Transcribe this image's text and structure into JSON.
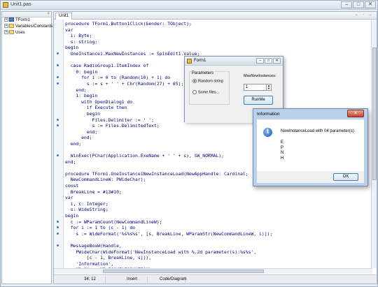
{
  "window": {
    "title": "Unit1.pas",
    "minimize": "–",
    "maximize": "□",
    "close": "✕"
  },
  "project_tree": {
    "close_label": "×",
    "items": [
      {
        "label": "TForm1",
        "icon": "form-icon"
      },
      {
        "label": "Variables/Constants",
        "icon": "folder-icon"
      },
      {
        "label": "Uses",
        "icon": "folder-icon"
      }
    ]
  },
  "editor": {
    "tab": "Unit1",
    "tab_nav": "← · →",
    "lines": [
      "procedure TForm1.Button1Click(Sender: TObject);",
      "var",
      "  i: Byte;",
      "  s: string;",
      "begin",
      "  OneInstance1.MaxNewInstances := SpinEdit1.Value;",
      "",
      "  case RadioGroup1.ItemIndex of",
      "    0: begin",
      "      for i := 0 to (Random(10) + 1) do",
      "        s := s + ' ' + Chr(Random(27) + 65);",
      "    end;",
      "    1: begin",
      "      with OpenDialog1 do",
      "        if Execute then",
      "        begin",
      "          Files.Delimiter := ' ';",
      "          s := Files.DelimitedText;",
      "        end;",
      "      end;",
      "  end;",
      "",
      "  WinExec(PChar(Application.ExeName + ' ' + s), SW_NORMAL);",
      "end;",
      "",
      "procedure TForm1.OneInstance1NewInstanceLoad(NewAppHandle: Cardinal;",
      "  NewCommandLineW: PWideChar);",
      "const",
      "  BreakLine = #13#10;",
      "var",
      "  i, c: Integer;",
      "  s: WideString;",
      "begin",
      "  c := WParamCount(NewCommandLineW);",
      "  for i := 1 to (c - 1) do",
      "    s := WideFormat('%s%s%s', [s, BreakLine, WParamStr(NewCommandLineW, i)]);",
      "",
      "  MessageBoxW(Handle,",
      "    PWideChar(WideFormat('NewInstanceLoad with %.2d parameter(s):%s%s',",
      "        [c - 1, BreakLine, s])),",
      "    'Information',",
      "    MB_OK or MB_ICONINFORMATION);",
      "end;"
    ],
    "status": {
      "position": "34: 12",
      "mode": "Insert",
      "view": "Code/Diagram"
    }
  },
  "form1": {
    "title": "Form1",
    "parameters_label": "Parameters",
    "radio_random": "Random string",
    "radio_files": "Some files...",
    "maxnew_label": "MaxNewInstances:",
    "maxnew_value": "1",
    "run_button": "RunMe",
    "buttons": {
      "minimize": "–",
      "maximize": "□",
      "close": "✕"
    }
  },
  "info_dialog": {
    "title": "Information",
    "close": "✕",
    "icon_glyph": "i",
    "message": "NewInstanceLoad with 04 parameter(s):",
    "params": [
      "E",
      "P",
      "N",
      "H"
    ],
    "ok_label": "OK"
  },
  "colors": {
    "code": "#000080",
    "gutter_dot": "#3b7bd6",
    "dialog_frame": "#b9d1ea",
    "close_red": "#c7432b"
  }
}
